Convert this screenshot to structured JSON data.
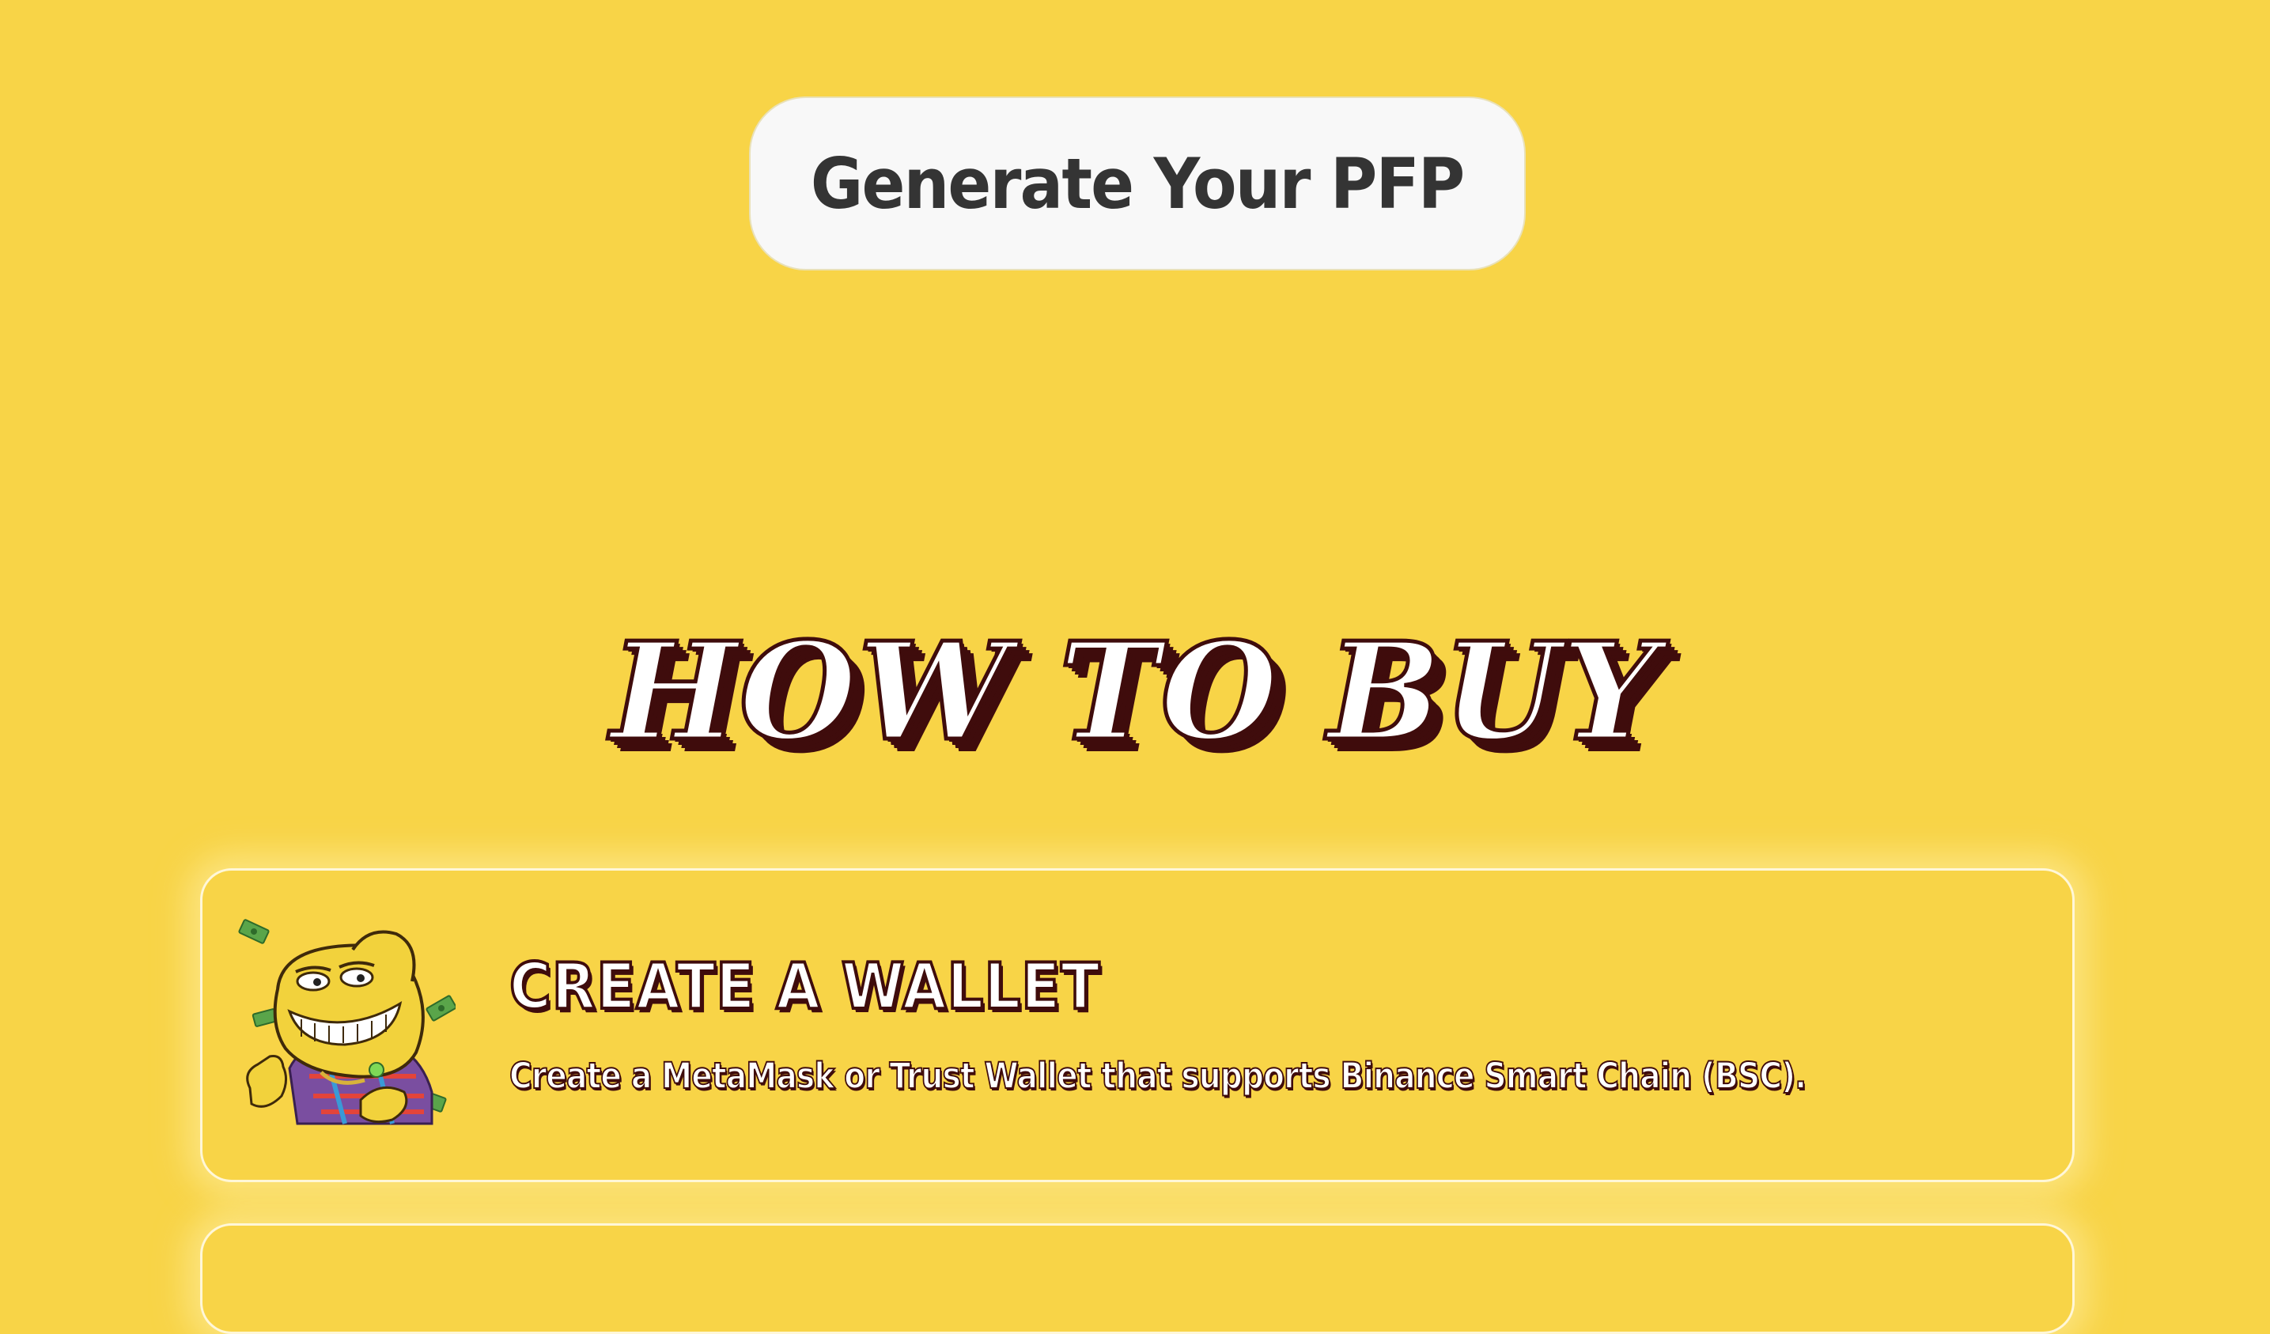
{
  "cta": {
    "generate_label": "Generate Your PFP"
  },
  "how_to_buy": {
    "heading": "HOW TO BUY",
    "steps": [
      {
        "title": "CREATE A WALLET",
        "description": "Create a MetaMask or Trust Wallet that supports Binance Smart Chain (BSC).",
        "icon": "mascot-money-icon"
      }
    ]
  },
  "colors": {
    "background": "#f8d447",
    "button": "#f8f8f8",
    "button_text": "#343434",
    "outline": "#3f0c0c",
    "card_border": "#fff7d8"
  }
}
